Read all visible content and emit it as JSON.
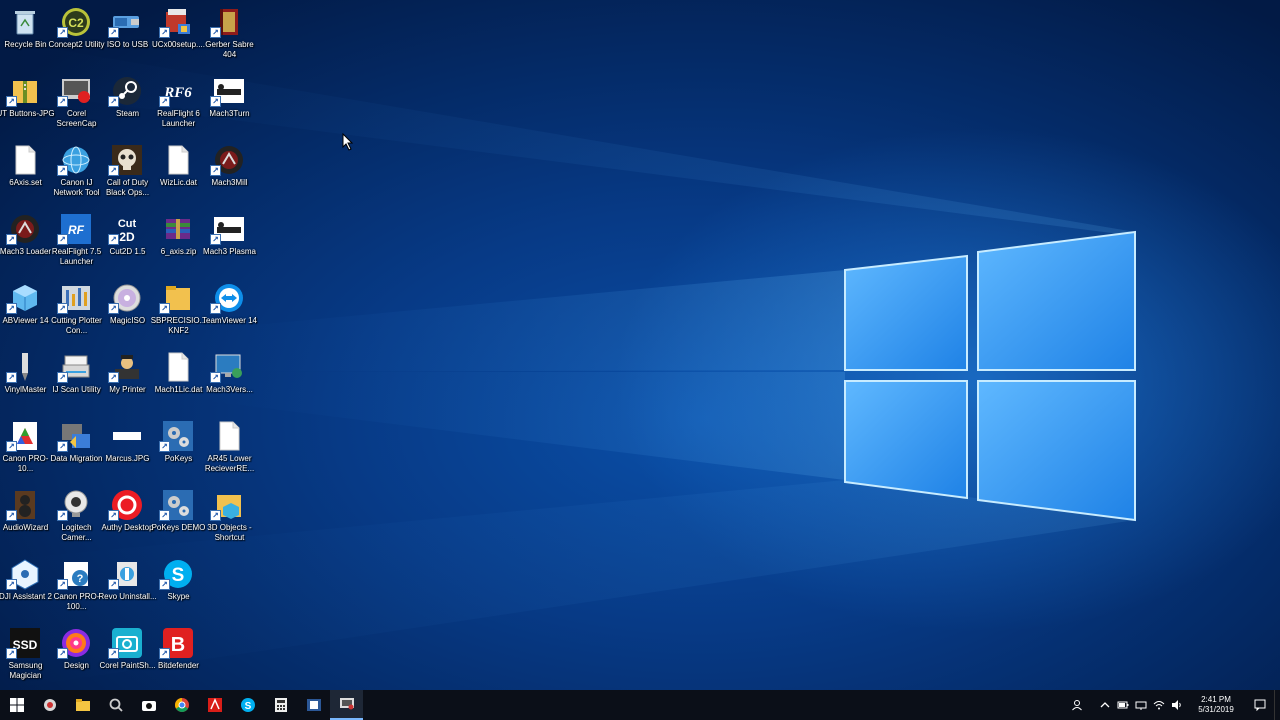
{
  "desktop": {
    "icons": [
      [
        "Recycle Bin",
        "recycle-bin-icon"
      ],
      [
        "Concept2 Utility",
        "concept2-icon"
      ],
      [
        "ISO to USB",
        "iso-to-usb-icon"
      ],
      [
        "UCx00setup....",
        "setup-installer-icon"
      ],
      [
        "Gerber Sabre 404",
        "book-icon"
      ],
      [
        "UT Buttons-JPG",
        "folder-zip-icon"
      ],
      [
        "Corel ScreenCap",
        "screencap-icon"
      ],
      [
        "Steam",
        "steam-icon"
      ],
      [
        "RealFlight 6 Launcher",
        "realflight6-icon"
      ],
      [
        "Mach3Turn",
        "mach3-icon"
      ],
      [
        "6Axis.set",
        "blank-file-icon"
      ],
      [
        "Canon IJ Network Tool",
        "globe-icon"
      ],
      [
        "Call of Duty Black Ops...",
        "skull-icon"
      ],
      [
        "WizLic.dat",
        "blank-file-icon"
      ],
      [
        "Mach3Mill",
        "mach3-round-icon"
      ],
      [
        "Mach3 Loader",
        "mach3-round-icon"
      ],
      [
        "RealFlight 7.5 Launcher",
        "realflight7-icon"
      ],
      [
        "Cut2D 1.5",
        "cut2d-icon"
      ],
      [
        "6_axis.zip",
        "winrar-icon"
      ],
      [
        "Mach3 Plasma",
        "mach3-icon"
      ],
      [
        "ABViewer 14",
        "cube-icon"
      ],
      [
        "Cutting Plotter Con...",
        "plotter-icon"
      ],
      [
        "MagicISO",
        "disc-icon"
      ],
      [
        "SBPRECISIO... KNF2",
        "folder-icon"
      ],
      [
        "TeamViewer 14",
        "teamviewer-icon"
      ],
      [
        "VinylMaster",
        "vinyl-icon"
      ],
      [
        "IJ Scan Utility",
        "scanner-icon"
      ],
      [
        "My Printer",
        "printer-user-icon"
      ],
      [
        "Mach1Lic.dat",
        "blank-file-icon"
      ],
      [
        "Mach3Vers...",
        "monitor-icon"
      ],
      [
        "Canon PRO-10...",
        "canon-icon"
      ],
      [
        "Data Migration",
        "migration-icon"
      ],
      [
        "Marcus.JPG",
        "image-icon"
      ],
      [
        "PoKeys",
        "gears-icon"
      ],
      [
        "AR45 Lower RecieverRE...",
        "blank-file-icon"
      ],
      [
        "AudioWizard",
        "speaker-icon"
      ],
      [
        "Logitech Camer...",
        "webcam-icon"
      ],
      [
        "Authy Desktop",
        "authy-icon"
      ],
      [
        "PoKeys DEMO",
        "gears-icon"
      ],
      [
        "3D Objects - Shortcut",
        "folder-3d-icon"
      ],
      [
        "DJI Assistant 2",
        "dji-icon"
      ],
      [
        "Canon PRO-100...",
        "canon-help-icon"
      ],
      [
        "Revo Uninstall...",
        "revo-icon"
      ],
      [
        "Skype",
        "skype-icon"
      ],
      "",
      [
        "Samsung Magician",
        "ssd-icon"
      ],
      [
        "Design",
        "design-icon"
      ],
      [
        "Corel PaintSh...",
        "camera-icon"
      ],
      [
        "Bitdefender",
        "bitdefender-icon"
      ]
    ]
  },
  "taskbar": {
    "buttons": [
      "start-button",
      "chrome-like-app",
      "file-explorer",
      "search-app",
      "camera-app",
      "chrome",
      "acrobat",
      "skype",
      "calculator",
      "word-app",
      "screen-app"
    ],
    "clock_time": "2:41 PM",
    "clock_date": "5/31/2019"
  },
  "colors": {
    "taskbar": "#0b0f18",
    "wallpaper_accent": "#3aa0f5"
  }
}
